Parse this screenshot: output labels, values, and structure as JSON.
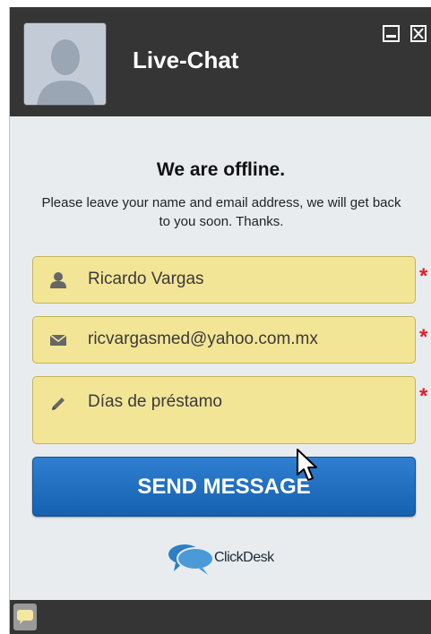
{
  "header": {
    "title": "Live-Chat"
  },
  "window_controls": {
    "minimize_icon": "minimize-icon",
    "close_icon": "close-icon"
  },
  "status": {
    "heading": "We are offline.",
    "message": "Please leave your name and email address, we will get back to you soon. Thanks."
  },
  "form": {
    "name": {
      "value": "Ricardo Vargas",
      "icon": "user-icon",
      "required_mark": "*"
    },
    "email": {
      "value": "ricvargasmed@yahoo.com.mx",
      "icon": "envelope-icon",
      "required_mark": "*"
    },
    "message": {
      "value": "Días de préstamo",
      "icon": "pencil-icon",
      "required_mark": "*"
    },
    "send_label": "SEND MESSAGE"
  },
  "branding": {
    "text": "ClickDesk"
  },
  "colors": {
    "header_bg": "#353535",
    "field_bg": "#f3e596",
    "button_bg": "#1a68b8",
    "required": "#e0202a"
  }
}
